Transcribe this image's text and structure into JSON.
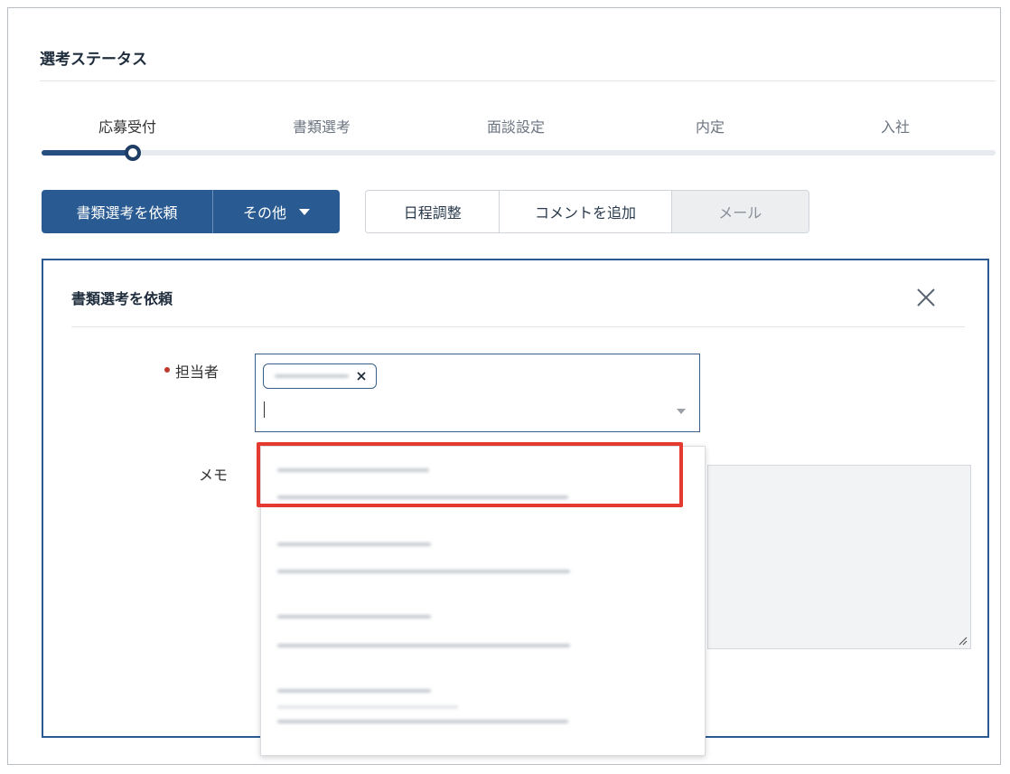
{
  "section": {
    "title": "選考ステータス"
  },
  "stepper": {
    "steps": [
      "応募受付",
      "書類選考",
      "面談設定",
      "内定",
      "入社"
    ],
    "active_index": 0
  },
  "actions": {
    "request_label": "書類選考を依頼",
    "other_label": "その他",
    "schedule_label": "日程調整",
    "comment_label": "コメントを追加",
    "mail_label": "メール"
  },
  "panel": {
    "title": "書類選考を依頼",
    "assignee_label": "担当者",
    "memo_label": "メモ"
  },
  "colors": {
    "primary": "#295b92",
    "stepper_fill": "#254f80",
    "required": "#c0392b",
    "highlight": "#e53a2f"
  },
  "icons": {
    "close": "close-icon",
    "caret": "chevron-down-icon",
    "tag_remove": "x-icon"
  }
}
